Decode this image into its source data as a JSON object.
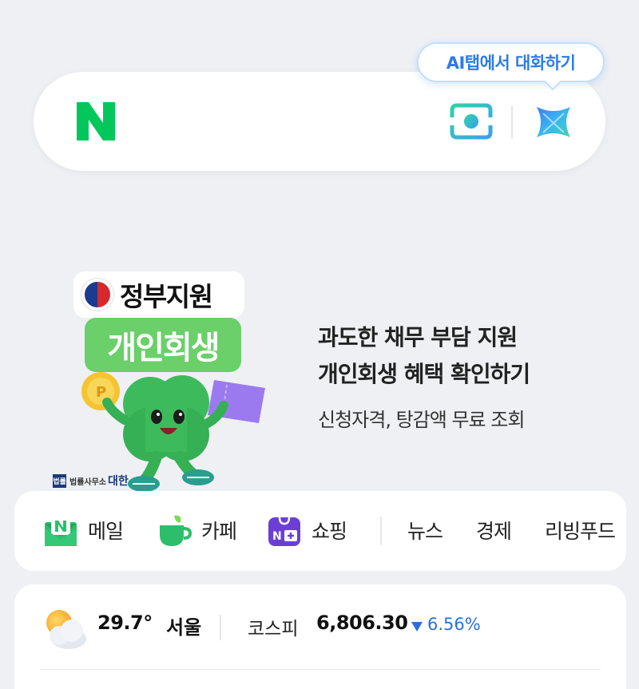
{
  "header": {
    "ai_tooltip": "AI탭에서 대화하기",
    "logo_letter": "N",
    "brand_green": "#03c75a",
    "lens_icon": "camera-lens-icon",
    "ai_icon": "ai-sparkle-icon"
  },
  "banner": {
    "gov_label": "정부지원",
    "badge_label": "개인회생",
    "title_line1": "과도한 채무 부담 지원",
    "title_line2": "개인회생 혜택 확인하기",
    "subtitle": "신청자격, 탕감액 무료 조회",
    "advertiser_mark": "법률",
    "advertiser_small": "법률사무소",
    "advertiser_name": "대한"
  },
  "shortcuts": {
    "services": [
      {
        "label": "메일",
        "icon": "mail-icon"
      },
      {
        "label": "카페",
        "icon": "cafe-icon"
      },
      {
        "label": "쇼핑",
        "icon": "shopping-icon"
      }
    ],
    "sections": [
      {
        "label": "뉴스"
      },
      {
        "label": "경제"
      },
      {
        "label": "리빙푸드"
      }
    ]
  },
  "info": {
    "weather_icon": "partly-cloudy-icon",
    "temperature": "29.7°",
    "city": "서울",
    "index_name": "코스피",
    "index_value": "6,806.30",
    "index_direction": "down",
    "index_change": "6.56%",
    "down_color": "#2a6fe0"
  }
}
